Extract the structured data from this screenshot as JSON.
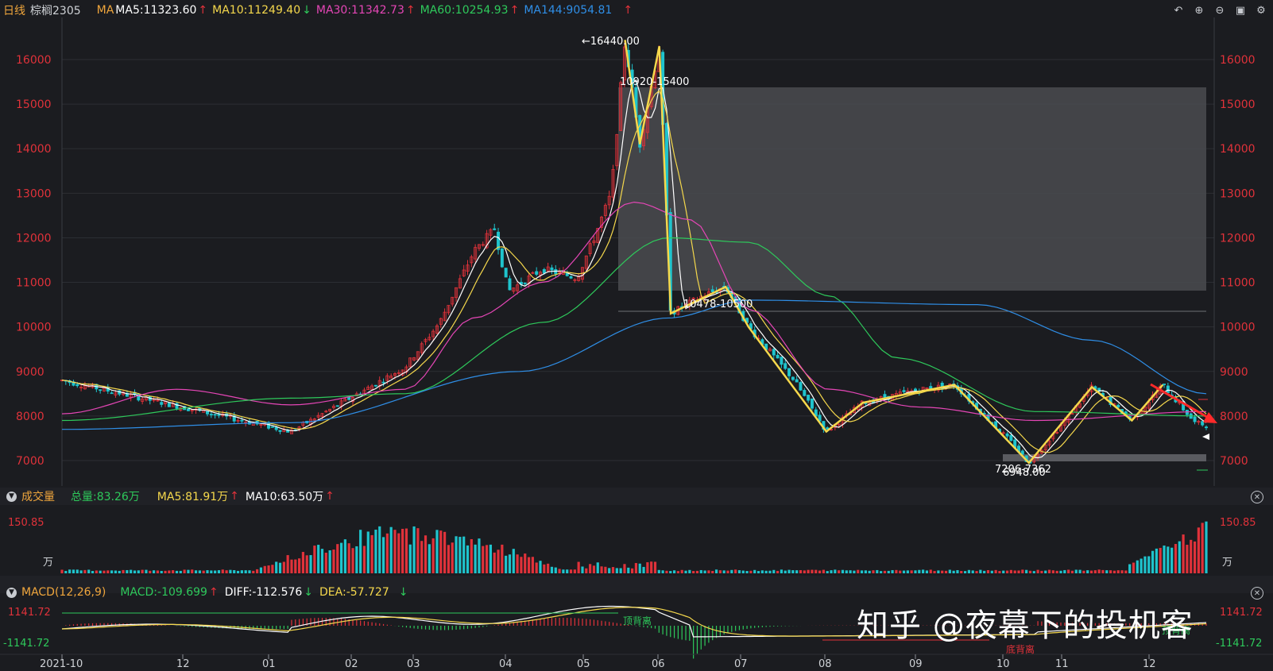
{
  "header": {
    "period": "日线",
    "symbol": "棕榈2305",
    "ma_label": "MA",
    "ma5": "MA5:11323.60",
    "ma10": "MA10:11249.40",
    "ma30": "MA30:11342.73",
    "ma60": "MA60:10254.93",
    "ma144": "MA144:9054.81",
    "up_arrow": "↑",
    "down_arrow": "↓"
  },
  "colors": {
    "up": "#e0323a",
    "down": "#1fc4cd",
    "ma5": "#ffffff",
    "ma10": "#f5d84c",
    "ma30": "#e546b6",
    "ma60": "#2ec95b",
    "ma144": "#2f8ee6",
    "grid": "#2c2e33",
    "axis_text": "#e0323a"
  },
  "toolbar": {
    "icons": [
      "back-icon",
      "zoom-in-icon",
      "zoom-out-icon",
      "layout-icon",
      "settings-icon"
    ]
  },
  "price_axis": {
    "ticks": [
      "16000",
      "15000",
      "14000",
      "13000",
      "12000",
      "11000",
      "10000",
      "9000",
      "8000",
      "7000"
    ]
  },
  "annotations": {
    "peak": "←16440.00",
    "zone_top": "10920-15400",
    "zone_mid": "10478-10500",
    "zone_low": "7206-7362",
    "low": "6948.00"
  },
  "volume": {
    "title": "成交量",
    "total": "总量:83.26万",
    "ma5": "MA5:81.91万",
    "ma10": "MA10:63.50万",
    "axis_top": "150.85",
    "unit": "万"
  },
  "macd": {
    "title": "MACD(12,26,9)",
    "macd": "MACD:-109.699",
    "diff": "DIFF:-112.576",
    "dea": "DEA:-57.727",
    "axis_top": "1141.72",
    "axis_bottom": "-1141.72",
    "top_div_1": "顶背离",
    "top_div_2": "顶背离",
    "bottom_div": "底背离"
  },
  "time_axis": {
    "labels": [
      "2021-10",
      "12",
      "01",
      "02",
      "03",
      "04",
      "05",
      "06",
      "07",
      "08",
      "09",
      "10",
      "11",
      "12"
    ]
  },
  "watermark": "知乎 @夜幕下的投机客",
  "chart_data": {
    "type": "candlestick",
    "ylim": [
      6800,
      16500
    ],
    "x_labels": [
      "2021-10",
      "12",
      "01",
      "02",
      "03",
      "04",
      "05",
      "06",
      "07",
      "08",
      "09",
      "10",
      "11",
      "12"
    ],
    "swing_points": [
      {
        "x": 0.0,
        "y": 8800
      },
      {
        "x": 0.2,
        "y": 7650
      },
      {
        "x": 0.3,
        "y": 9100
      },
      {
        "x": 0.33,
        "y": 10100
      },
      {
        "x": 0.36,
        "y": 11700
      },
      {
        "x": 0.378,
        "y": 12200
      },
      {
        "x": 0.39,
        "y": 10800
      },
      {
        "x": 0.42,
        "y": 11300
      },
      {
        "x": 0.45,
        "y": 11100
      },
      {
        "x": 0.465,
        "y": 12000
      },
      {
        "x": 0.48,
        "y": 13000
      },
      {
        "x": 0.492,
        "y": 16440
      },
      {
        "x": 0.505,
        "y": 14100
      },
      {
        "x": 0.522,
        "y": 16300
      },
      {
        "x": 0.532,
        "y": 10300
      },
      {
        "x": 0.56,
        "y": 10700
      },
      {
        "x": 0.58,
        "y": 10900
      },
      {
        "x": 0.6,
        "y": 10000
      },
      {
        "x": 0.64,
        "y": 8800
      },
      {
        "x": 0.668,
        "y": 7650
      },
      {
        "x": 0.7,
        "y": 8300
      },
      {
        "x": 0.75,
        "y": 8600
      },
      {
        "x": 0.78,
        "y": 8700
      },
      {
        "x": 0.83,
        "y": 7400
      },
      {
        "x": 0.845,
        "y": 6948
      },
      {
        "x": 0.88,
        "y": 8000
      },
      {
        "x": 0.9,
        "y": 8650
      },
      {
        "x": 0.935,
        "y": 7900
      },
      {
        "x": 0.962,
        "y": 8700
      },
      {
        "x": 0.99,
        "y": 7850
      },
      {
        "x": 1.0,
        "y": 7800
      }
    ],
    "ma_lines": {
      "MA30": [
        [
          0,
          8050
        ],
        [
          0.1,
          8600
        ],
        [
          0.2,
          8250
        ],
        [
          0.3,
          8600
        ],
        [
          0.36,
          10200
        ],
        [
          0.42,
          11000
        ],
        [
          0.5,
          12800
        ],
        [
          0.55,
          12400
        ],
        [
          0.6,
          10400
        ],
        [
          0.67,
          8600
        ],
        [
          0.75,
          8200
        ],
        [
          0.85,
          7900
        ],
        [
          1,
          8100
        ]
      ],
      "MA60": [
        [
          0,
          7900
        ],
        [
          0.2,
          8400
        ],
        [
          0.3,
          8500
        ],
        [
          0.42,
          10100
        ],
        [
          0.53,
          12000
        ],
        [
          0.6,
          11900
        ],
        [
          0.67,
          10700
        ],
        [
          0.73,
          9300
        ],
        [
          0.85,
          8100
        ],
        [
          1,
          8000
        ]
      ],
      "MA144": [
        [
          0,
          7700
        ],
        [
          0.2,
          7850
        ],
        [
          0.4,
          9000
        ],
        [
          0.53,
          10200
        ],
        [
          0.6,
          10600
        ],
        [
          0.8,
          10500
        ],
        [
          0.9,
          9700
        ],
        [
          1,
          8500
        ]
      ]
    }
  }
}
